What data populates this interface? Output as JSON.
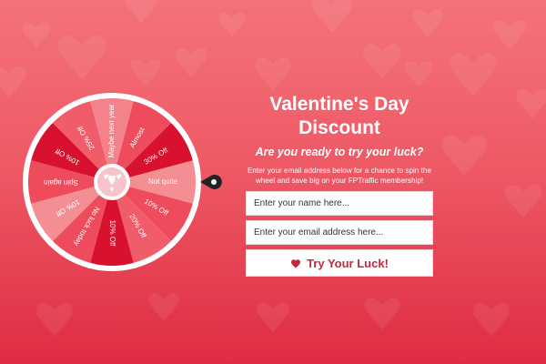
{
  "popup": {
    "title": "Valentine's Day Discount",
    "subtitle": "Are you ready to try your luck?",
    "description": "Enter your email address below for a chance to spin the wheel and save big on your FPTraffic membership!",
    "name_placeholder": "Enter your name here...",
    "email_placeholder": "Enter your email address here...",
    "button_label": "Try Your Luck!"
  },
  "wheel": {
    "segments": [
      {
        "label": "Not quite",
        "color": "#f38e93"
      },
      {
        "label": "10% Off",
        "color": "#ee4b5c"
      },
      {
        "label": "20% Off",
        "color": "#f05c69"
      },
      {
        "label": "10% Off",
        "color": "#d8122e"
      },
      {
        "label": "No luck today",
        "color": "#ee4b5c"
      },
      {
        "label": "10% Off",
        "color": "#f38e93"
      },
      {
        "label": "Spin again",
        "color": "#ee4b5c"
      },
      {
        "label": "10% Off",
        "color": "#d8122e"
      },
      {
        "label": "25% Off",
        "color": "#f05c69"
      },
      {
        "label": "Maybe next year",
        "color": "#f4828a"
      },
      {
        "label": "Almost",
        "color": "#ee4b5c"
      },
      {
        "label": "30% Off",
        "color": "#d8122e"
      }
    ]
  },
  "colors": {
    "accent": "#c4283c",
    "background_top": "#f4727a",
    "background_bottom": "#df2c43"
  },
  "icons": {
    "button_icon": "heart-icon",
    "wheel_center": "hearts-icon",
    "pointer": "pointer-icon"
  }
}
